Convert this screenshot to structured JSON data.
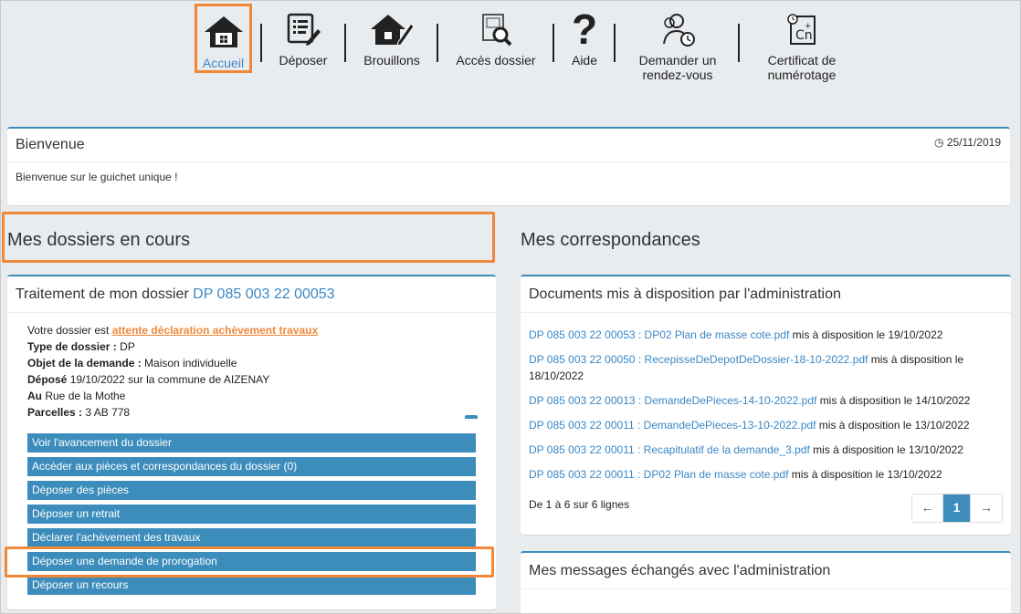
{
  "nav": {
    "items": [
      {
        "label": "Accueil",
        "icon": "home-icon"
      },
      {
        "label": "Déposer",
        "icon": "form-edit-icon"
      },
      {
        "label": "Brouillons",
        "icon": "house-draft-icon"
      },
      {
        "label": "Accès dossier",
        "icon": "folder-search-icon"
      },
      {
        "label": "Aide",
        "icon": "question-icon"
      },
      {
        "label": "Demander un",
        "label2": "rendez-vous",
        "icon": "users-clock-icon"
      },
      {
        "label": "Certificat de",
        "label2": "numérotage",
        "icon": "certificate-cn-icon"
      }
    ]
  },
  "welcome": {
    "title": "Bienvenue",
    "date": "25/11/2019",
    "message": "Bienvenue sur le guichet unique !"
  },
  "dossiers": {
    "section_title": "Mes dossiers en cours",
    "panel_title": "Traitement de mon dossier",
    "panel_ref": "DP 085 003 22 00053",
    "status_prefix": "Votre dossier est",
    "status_link": "attente déclaration achèvement travaux",
    "type_label": "Type de dossier :",
    "type_value": "DP",
    "objet_label": "Objet de la demande :",
    "objet_value": "Maison individuelle",
    "depose_label": "Déposé",
    "depose_value": "19/10/2022 sur la commune de AIZENAY",
    "au_label": "Au",
    "au_value": "Rue de la Mothe",
    "parcelles_label": "Parcelles :",
    "parcelles_value": "3 AB 778",
    "actions": [
      "Voir l'avancement du dossier",
      "Accéder aux pièces et correspondances du dossier (0)",
      "Déposer des pièces",
      "Déposer un retrait",
      "Déclarer l'achèvement des travaux",
      "Déposer une demande de prorogation",
      "Déposer un recours"
    ]
  },
  "correspondances": {
    "section_title": "Mes correspondances",
    "docs_title": "Documents mis à disposition par l'administration",
    "docs": [
      {
        "link": "DP 085 003 22 00053 : DP02 Plan de masse cote.pdf",
        "text": "mis à disposition le 19/10/2022"
      },
      {
        "link": "DP 085 003 22 00050 : RecepisseDeDepotDeDossier-18-10-2022.pdf",
        "text": "mis à disposition le 18/10/2022"
      },
      {
        "link": "DP 085 003 22 00013 : DemandeDePieces-14-10-2022.pdf",
        "text": "mis à disposition le 14/10/2022"
      },
      {
        "link": "DP 085 003 22 00011 : DemandeDePieces-13-10-2022.pdf",
        "text": "mis à disposition le 13/10/2022"
      },
      {
        "link": "DP 085 003 22 00011 : Recapitulatif de la demande_3.pdf",
        "text": "mis à disposition le 13/10/2022"
      },
      {
        "link": "DP 085 003 22 00011 : DP02 Plan de masse cote.pdf",
        "text": "mis à disposition le 13/10/2022"
      }
    ],
    "count": "De 1 à 6 sur 6 lignes",
    "pager": {
      "prev": "←",
      "current": "1",
      "next": "→"
    },
    "messages_title": "Mes messages échangés avec l'administration"
  },
  "colors": {
    "accent": "#3c8dbc",
    "highlight": "#f0883a",
    "link": "#3a87c5"
  }
}
